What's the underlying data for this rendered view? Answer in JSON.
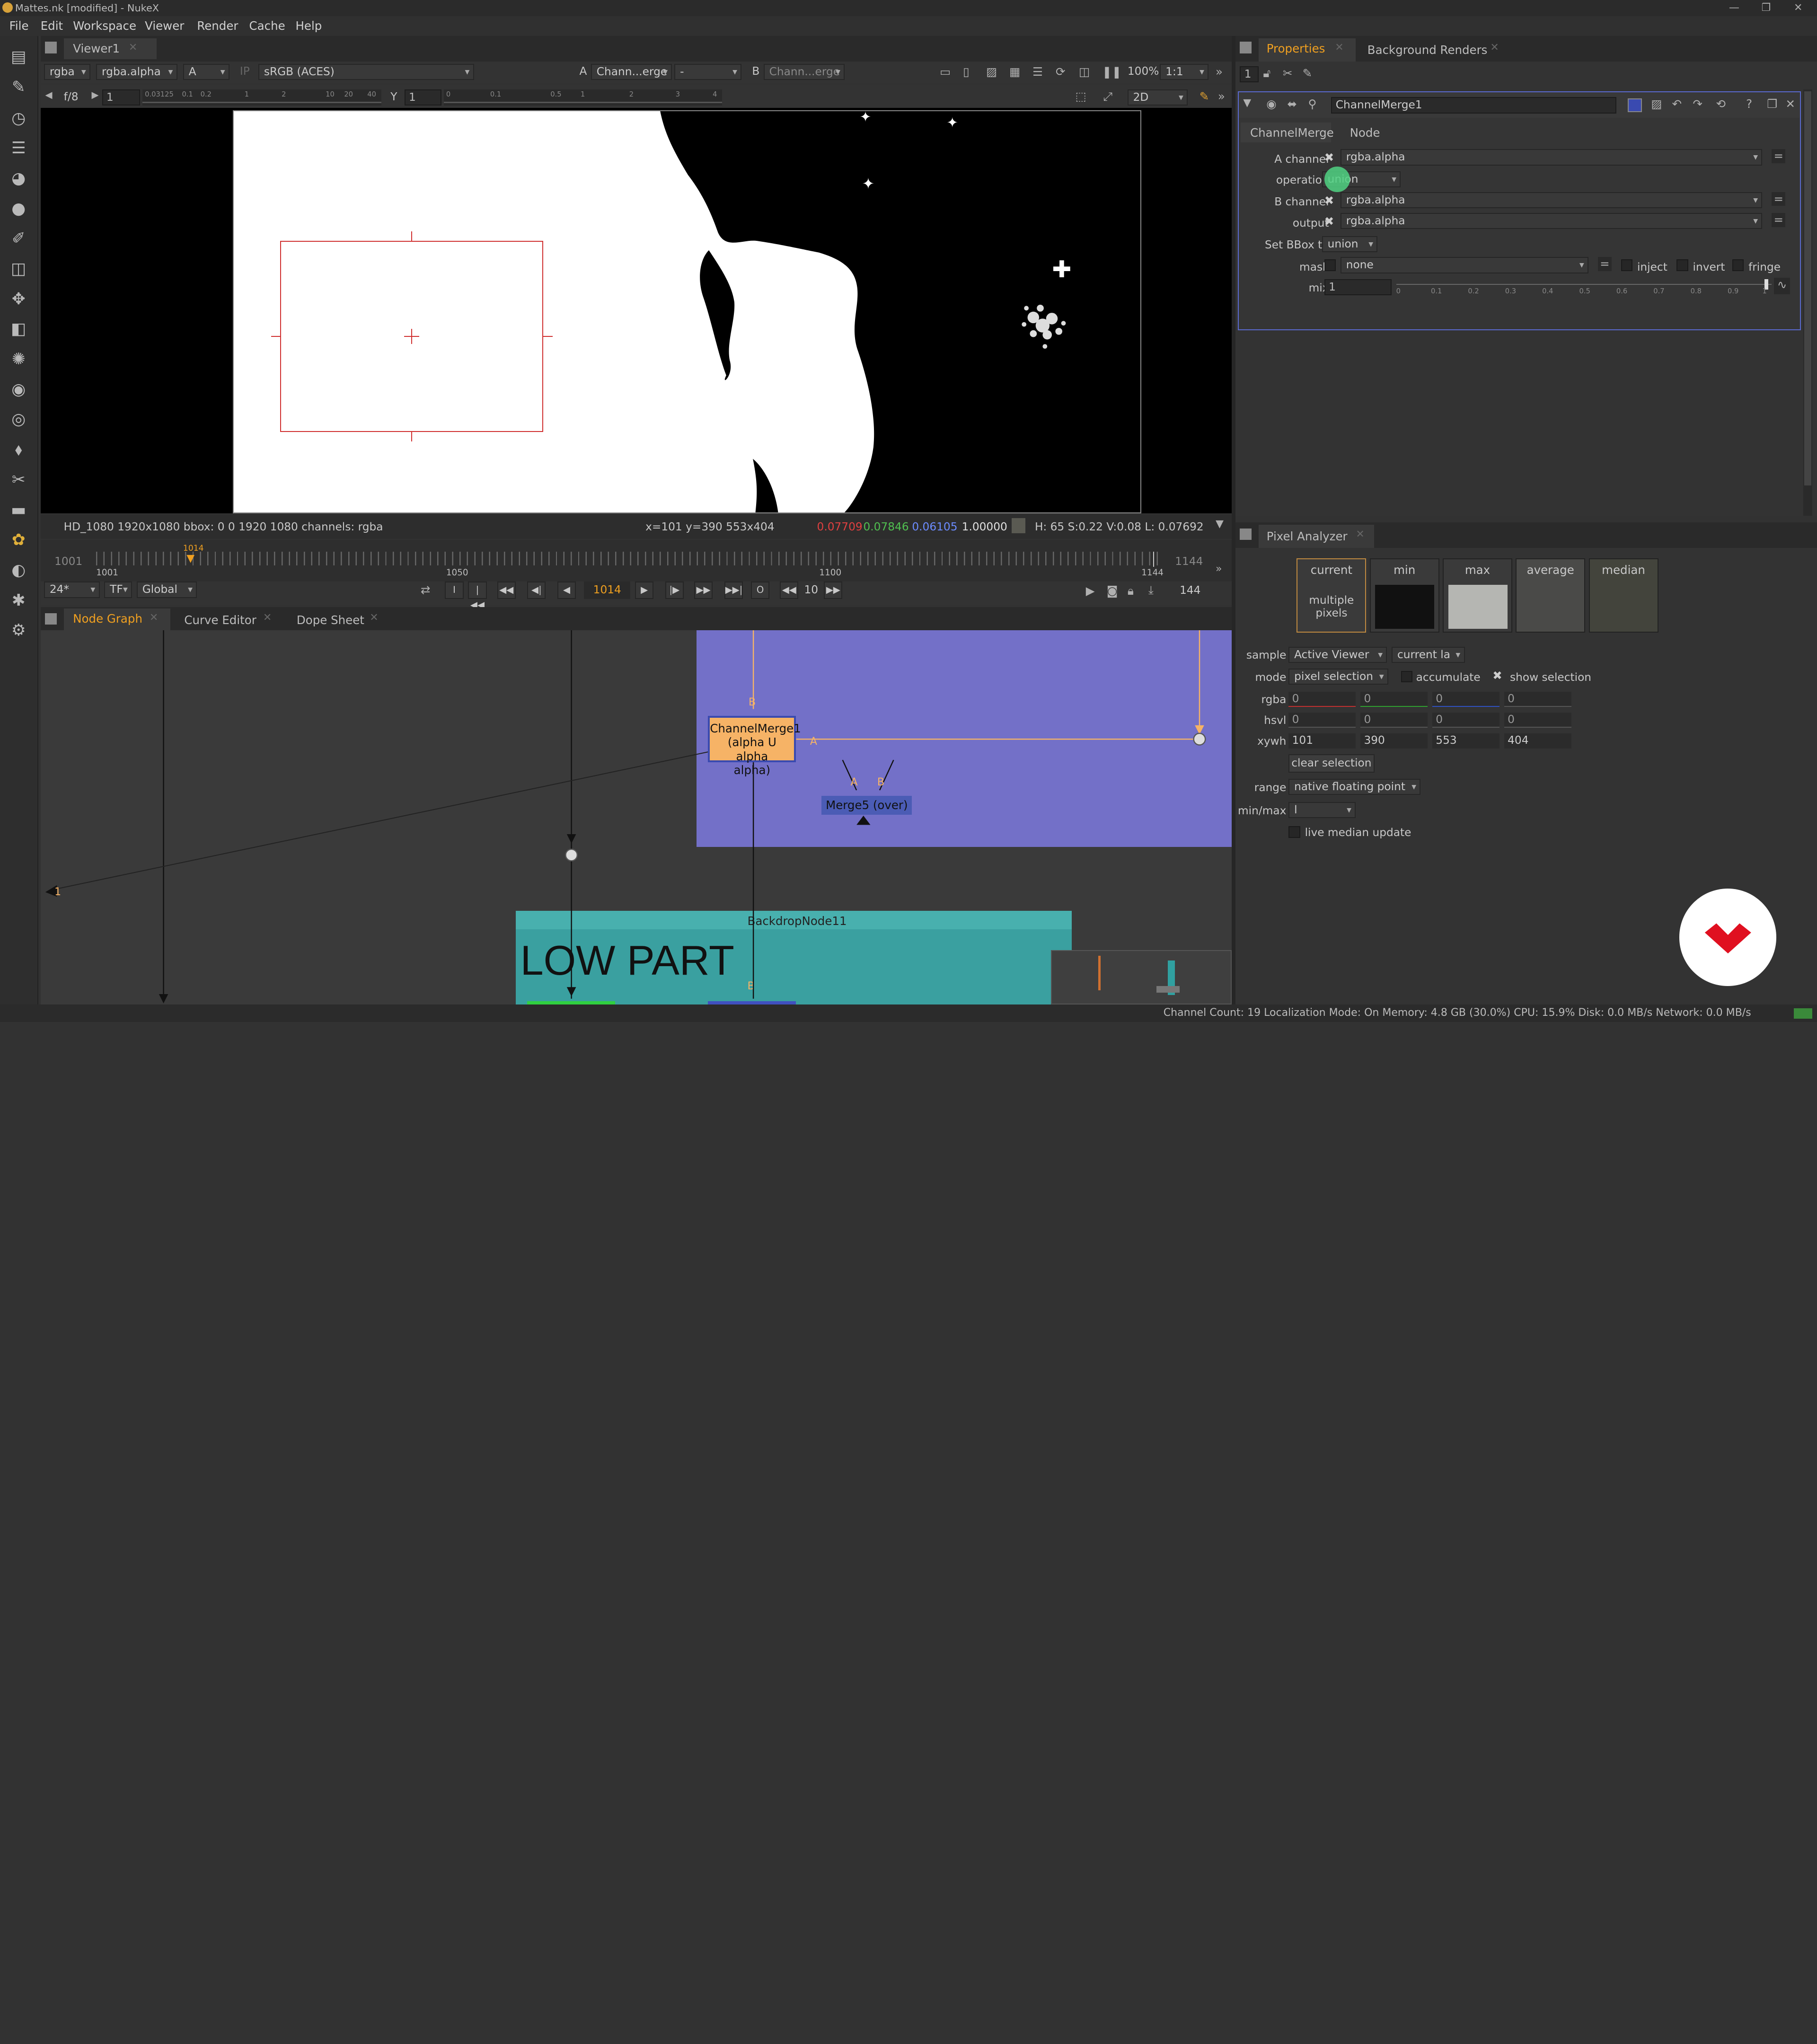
{
  "window": {
    "title": "Mattes.nk [modified] - NukeX"
  },
  "menu": [
    "File",
    "Edit",
    "Workspace",
    "Viewer",
    "Render",
    "Cache",
    "Help"
  ],
  "viewer": {
    "tab": "Viewer1",
    "channels": "rgba",
    "channel2": "rgba.alpha",
    "input_a": "A",
    "ip": "IP",
    "colorspace": "sRGB (ACES)",
    "a_label": "A",
    "a_input": "Chann...erge",
    "a_op": "-",
    "b_label": "B",
    "b_input": "Chann...erge",
    "zoom": "100%",
    "ratio": "1:1",
    "fstop": "f/8",
    "gain_value": "1",
    "gamma_label": "Y",
    "gamma_value": "1",
    "view_mode": "2D",
    "gain_ticks": [
      "0.03125",
      "0.1",
      "0.2",
      "1",
      "2",
      "10",
      "20",
      "40"
    ],
    "gamma_ticks": [
      "0",
      "0.1",
      "0.5",
      "1",
      "2",
      "3",
      "4"
    ],
    "status_left": "HD_1080 1920x1080  bbox: 0 0 1920 1080 channels: rgba",
    "status_coords": "x=101 y=390 553x404",
    "status_r": "0.07709",
    "status_g": "0.07846",
    "status_b": "0.06105",
    "status_a": "1.00000",
    "status_hsvl": "H: 65 S:0.22 V:0.08  L: 0.07692"
  },
  "timeline": {
    "start": "1001",
    "end": "1144",
    "current_marker": "1014",
    "ticks": [
      "1001",
      "1050",
      "1100",
      "1144"
    ],
    "fps": "24*",
    "tf": "TF",
    "scope": "Global",
    "frame": "1014",
    "step": "10",
    "frame_count": "144",
    "colors": {
      "marker": "#f0a020"
    }
  },
  "nodegraph": {
    "tabs": [
      "Node Graph",
      "Curve Editor",
      "Dope Sheet"
    ],
    "nodes": {
      "channelmerge": {
        "label": "ChannelMerge1\n(alpha U alpha\nalpha)",
        "input_b": "B",
        "input_a": "A"
      },
      "merge5": {
        "label": "Merge5 (over)",
        "input_a": "A",
        "input_b": "B"
      }
    },
    "backdrop": {
      "title": "BackdropNode11",
      "text": "LOW PART",
      "input_b": "B"
    },
    "marker_label": "1",
    "colors": {
      "backdrop_purple": "#7370c8",
      "backdrop_teal": "#3aa0a0",
      "channelmerge": "#f6b366",
      "merge5": "#4b5cb5"
    }
  },
  "properties": {
    "tabs": [
      "Properties",
      "Background Renders"
    ],
    "max_panels": "1",
    "node_name": "ChannelMerge1",
    "subtabs": [
      "ChannelMerge",
      "Node"
    ],
    "fields": [
      {
        "label": "A channel",
        "value": "rgba.alpha"
      },
      {
        "label": "operation",
        "value": "union"
      },
      {
        "label": "B channel",
        "value": "rgba.alpha"
      },
      {
        "label": "output",
        "value": "rgba.alpha"
      },
      {
        "label": "Set BBox to",
        "value": "union"
      }
    ],
    "mask_label": "mask",
    "mask_value": "none",
    "inject": "inject",
    "invert": "invert",
    "fringe": "fringe",
    "mix_label": "mix",
    "mix_value": "1",
    "mix_ticks": [
      "0",
      "0.1",
      "0.2",
      "0.3",
      "0.4",
      "0.5",
      "0.6",
      "0.7",
      "0.8",
      "0.9",
      "1"
    ]
  },
  "pixel_analyzer": {
    "tab": "Pixel Analyzer",
    "swatches": [
      "current",
      "min",
      "max",
      "average",
      "median"
    ],
    "current_note": "multiple pixels",
    "sample_label": "sample",
    "sample_value": "Active Viewer",
    "sample_value2": "current la",
    "mode_label": "mode",
    "mode_value": "pixel selection",
    "accumulate": "accumulate",
    "show_selection": "show selection",
    "rows": [
      {
        "label": "rgba",
        "values": [
          "0",
          "0",
          "0",
          "0"
        ]
      },
      {
        "label": "hsvl",
        "values": [
          "0",
          "0",
          "0",
          "0"
        ]
      },
      {
        "label": "xywh",
        "values": [
          "101",
          "390",
          "553",
          "404"
        ]
      }
    ],
    "clear": "clear selection",
    "range_label": "range",
    "range_value": "native floating point",
    "minmax_label": "min/max",
    "minmax_value": "l",
    "live_median": "live median update",
    "colors": {
      "min": "#111111",
      "max": "#b5b6b2",
      "average": "#4a4a48",
      "median": "#43443c"
    }
  },
  "statusbar": {
    "text": "Channel Count: 19  Localization Mode: On  Memory: 4.8 GB (30.0%)  CPU: 15.9%  Disk: 0.0 MB/s  Network: 0.0 MB/s"
  }
}
